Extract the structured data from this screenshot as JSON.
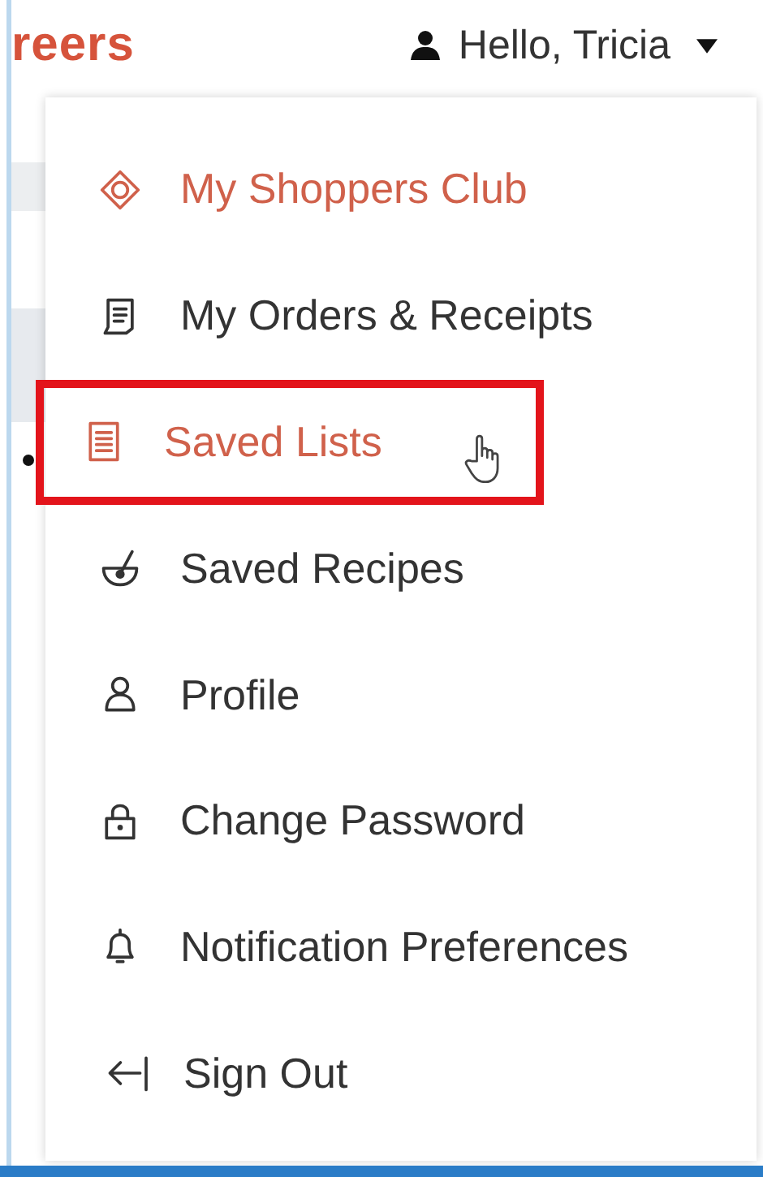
{
  "header": {
    "brand_fragment": "reers",
    "greeting": "Hello, Tricia"
  },
  "account_menu": {
    "items": [
      {
        "label": "My Shoppers Club",
        "kind": "club",
        "selected": false
      },
      {
        "label": "My Orders & Receipts",
        "kind": "link",
        "selected": false
      },
      {
        "label": "Saved Lists",
        "kind": "link",
        "selected": true
      },
      {
        "label": "Saved Recipes",
        "kind": "link",
        "selected": false
      },
      {
        "label": "Profile",
        "kind": "link",
        "selected": false
      },
      {
        "label": "Change Password",
        "kind": "link",
        "selected": false
      },
      {
        "label": "Notification Preferences",
        "kind": "link",
        "selected": false
      },
      {
        "label": "Sign Out",
        "kind": "link",
        "selected": false
      }
    ]
  }
}
